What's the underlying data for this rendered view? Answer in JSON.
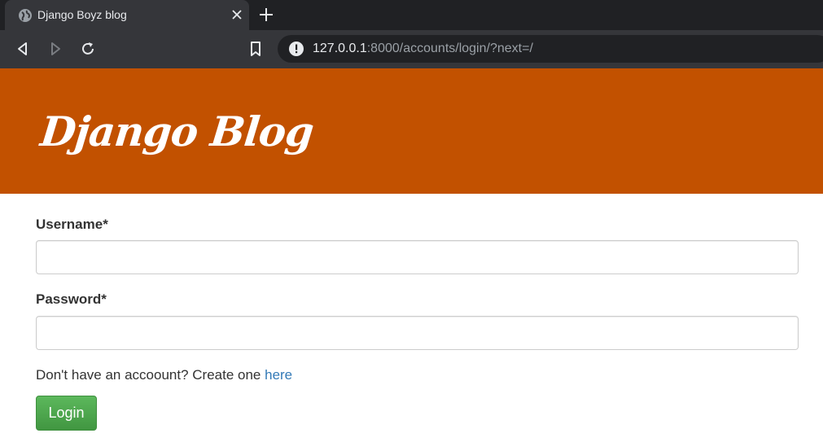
{
  "browser": {
    "tab_title": "Django Boyz blog",
    "url_host": "127.0.0.1",
    "url_rest": ":8000/accounts/login/?next=/",
    "icons": {
      "favicon": "globe-icon",
      "close": "close-icon",
      "new_tab": "plus-icon",
      "back": "back-arrow-icon",
      "forward": "forward-arrow-icon",
      "reload": "reload-icon",
      "bookmark": "bookmark-icon",
      "site_info": "info-icon"
    }
  },
  "header": {
    "title": "Django Blog",
    "background_color": "#c25100"
  },
  "form": {
    "username_label": "Username*",
    "username_value": "",
    "password_label": "Password*",
    "password_value": "",
    "signup_prompt": "Don't have an accoount? Create one ",
    "signup_link": "here",
    "submit_label": "Login",
    "link_color": "#337ab7",
    "button_color": "#4cae4c"
  }
}
